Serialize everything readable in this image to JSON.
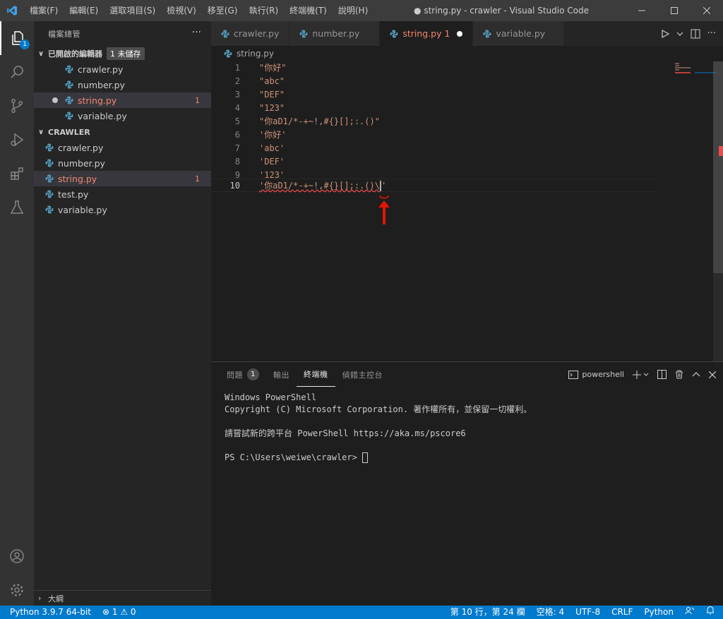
{
  "menu": [
    "檔案(F)",
    "編輯(E)",
    "選取項目(S)",
    "檢視(V)",
    "移至(G)",
    "執行(R)",
    "終端機(T)",
    "說明(H)"
  ],
  "window_title": "● string.py - crawler - Visual Studio Code",
  "activity": {
    "explorer_badge": "1"
  },
  "sidebar": {
    "title": "檔案總管",
    "more": "···",
    "open_editors": {
      "label": "已開啟的編輯器",
      "unsaved_badge": "1 未儲存",
      "files": [
        {
          "name": "crawler.py"
        },
        {
          "name": "number.py"
        },
        {
          "name": "string.py",
          "errors": "1"
        },
        {
          "name": "variable.py"
        }
      ]
    },
    "folder": {
      "label": "CRAWLER",
      "files": [
        {
          "name": "crawler.py"
        },
        {
          "name": "number.py"
        },
        {
          "name": "string.py",
          "errors": "1"
        },
        {
          "name": "test.py"
        },
        {
          "name": "variable.py"
        }
      ]
    },
    "outline_label": "大綱"
  },
  "tabs": [
    {
      "label": "crawler.py"
    },
    {
      "label": "number.py"
    },
    {
      "label": "string.py 1"
    },
    {
      "label": "variable.py"
    }
  ],
  "breadcrumb": "string.py",
  "editor": {
    "lines": [
      {
        "n": "1",
        "text": "\"你好\""
      },
      {
        "n": "2",
        "text": "\"abc\""
      },
      {
        "n": "3",
        "text": "\"DEF\""
      },
      {
        "n": "4",
        "text": "\"123\""
      },
      {
        "n": "5",
        "text": "\"你aD1/*-+~!,#{}[];:.()\""
      },
      {
        "n": "6",
        "text": "'你好'"
      },
      {
        "n": "7",
        "text": "'abc'"
      },
      {
        "n": "8",
        "text": "'DEF'"
      },
      {
        "n": "9",
        "text": "'123'"
      },
      {
        "n": "10",
        "text_before_cursor": "'你aD1/*-+~!,#{}[];:.()\\",
        "text_after_cursor": "'"
      }
    ]
  },
  "panel": {
    "tabs": {
      "problems": "問題",
      "problems_count": "1",
      "output": "輸出",
      "terminal": "終端機",
      "debug": "偵錯主控台"
    },
    "shell": "powershell",
    "terminal_lines": [
      "Windows PowerShell",
      "Copyright (C) Microsoft Corporation. 著作權所有，並保留一切權利。",
      "",
      "請嘗試新的跨平台 PowerShell https://aka.ms/pscore6",
      "",
      "PS C:\\Users\\weiwe\\crawler> "
    ]
  },
  "status": {
    "python": "Python 3.9.7 64-bit",
    "problems": "⊗ 1 ⚠ 0",
    "position": "第 10 行，第 24 欄",
    "spaces": "空格: 4",
    "encoding": "UTF-8",
    "eol": "CRLF",
    "language": "Python"
  },
  "colors": {
    "accent": "#007acc",
    "error": "#f48771",
    "string": "#ce9178",
    "annotation_arrow": "#e51400"
  }
}
